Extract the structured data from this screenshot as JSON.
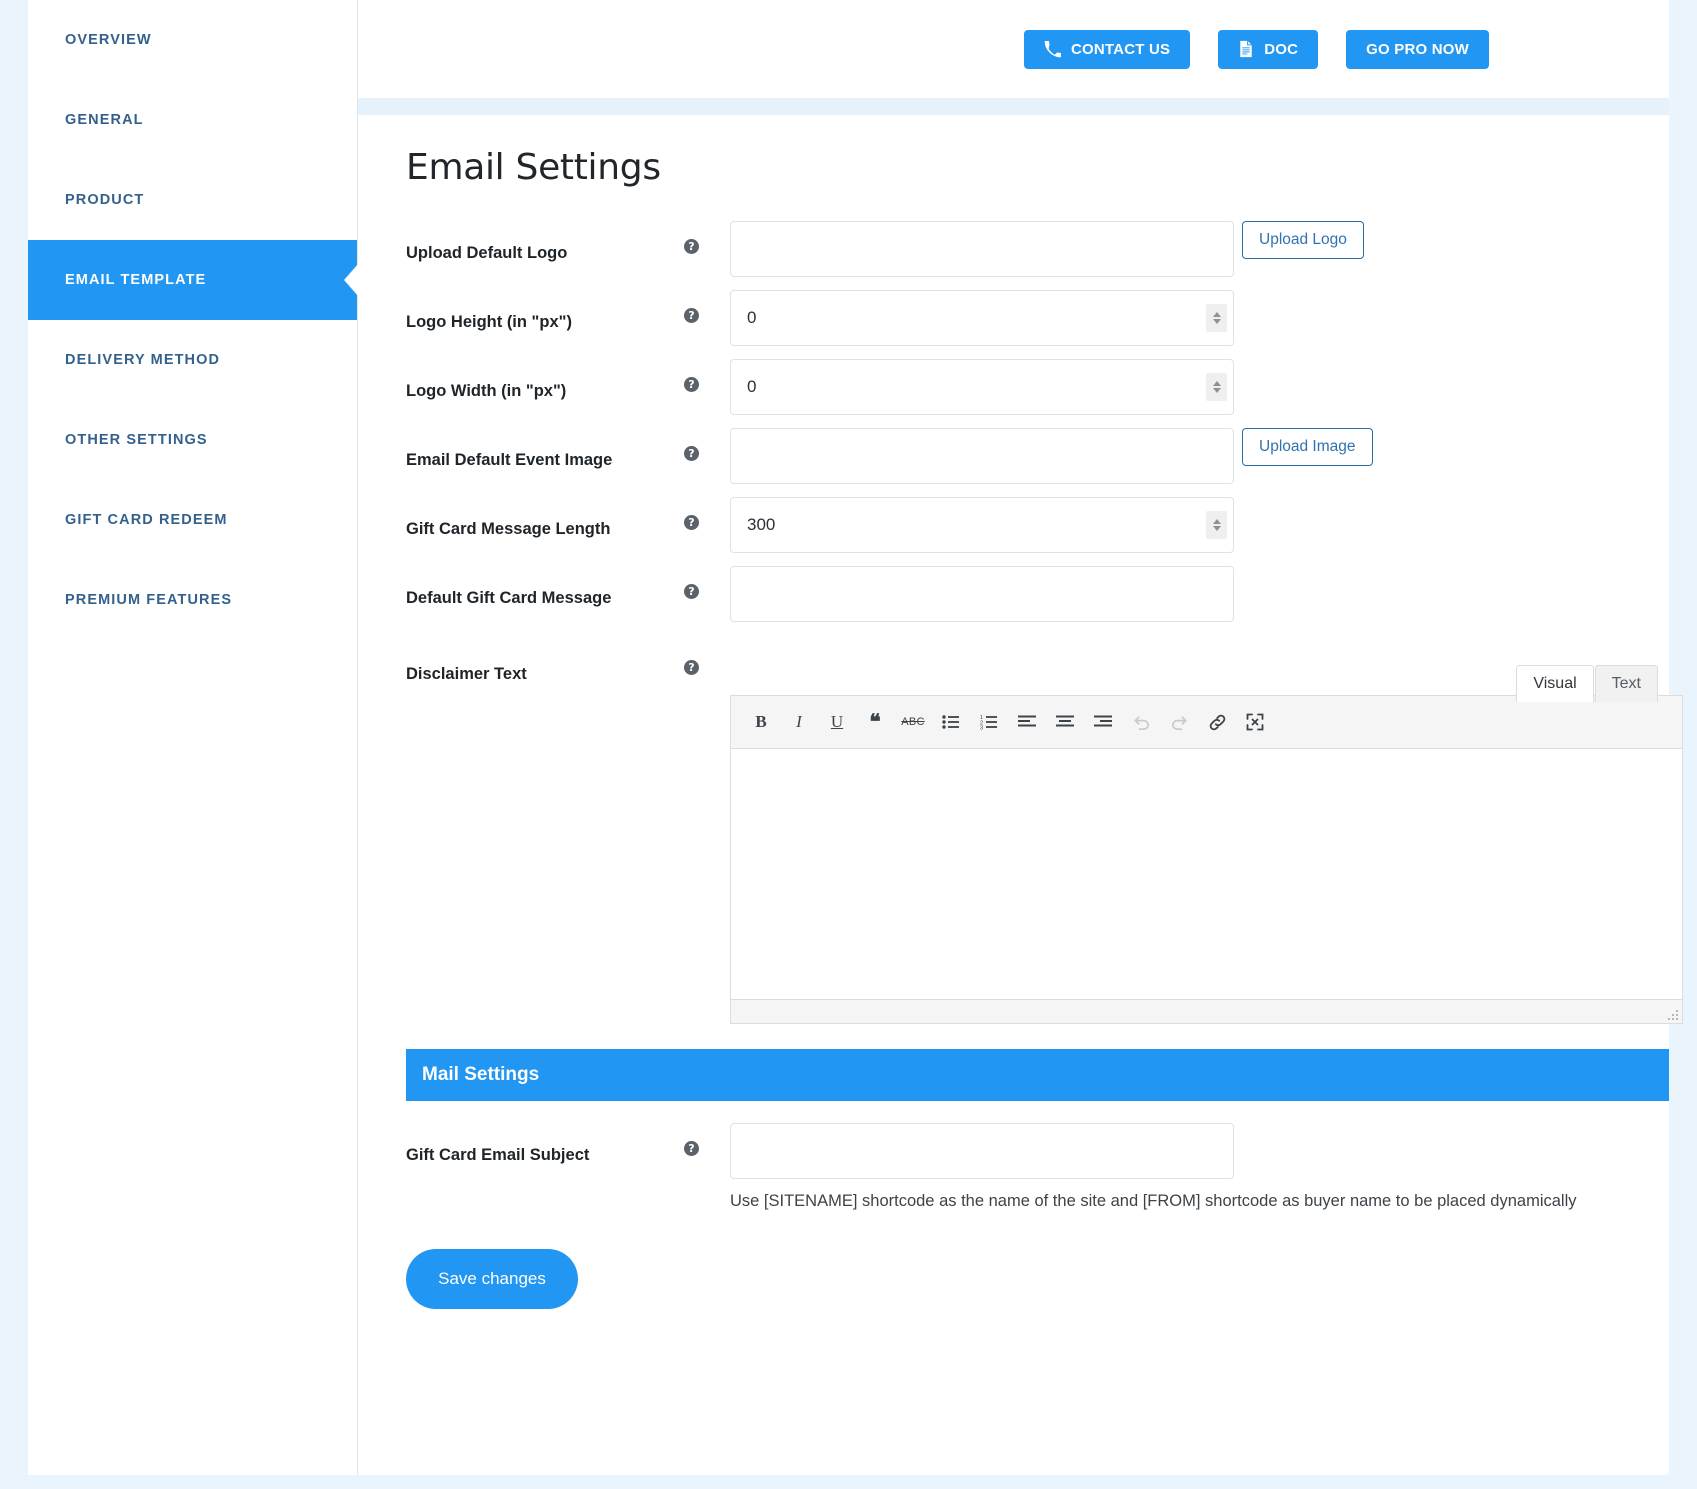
{
  "topbar": {
    "buttons": [
      {
        "label": "CONTACT US",
        "icon": "phone-icon"
      },
      {
        "label": "DOC",
        "icon": "document-icon"
      },
      {
        "label": "GO PRO NOW",
        "icon": ""
      }
    ]
  },
  "sidebar": {
    "items": [
      {
        "label": "OVERVIEW",
        "active": false
      },
      {
        "label": "GENERAL",
        "active": false
      },
      {
        "label": "PRODUCT",
        "active": false
      },
      {
        "label": "EMAIL TEMPLATE",
        "active": true
      },
      {
        "label": "DELIVERY METHOD",
        "active": false
      },
      {
        "label": "OTHER SETTINGS",
        "active": false
      },
      {
        "label": "GIFT CARD REDEEM",
        "active": false
      },
      {
        "label": "PREMIUM FEATURES",
        "active": false
      }
    ]
  },
  "main": {
    "title": "Email Settings",
    "fields": {
      "upload_logo": {
        "label": "Upload Default Logo",
        "value": "",
        "button": "Upload Logo"
      },
      "logo_height": {
        "label": "Logo Height (in \"px\")",
        "value": "0"
      },
      "logo_width": {
        "label": "Logo Width (in \"px\")",
        "value": "0"
      },
      "event_image": {
        "label": "Email Default Event Image",
        "value": "",
        "button": "Upload Image"
      },
      "message_length": {
        "label": "Gift Card Message Length",
        "value": "300"
      },
      "default_message": {
        "label": "Default Gift Card Message",
        "value": ""
      },
      "disclaimer": {
        "label": "Disclaimer Text",
        "value": ""
      },
      "email_subject": {
        "label": "Gift Card Email Subject",
        "value": ""
      }
    },
    "editor": {
      "tabs": [
        {
          "label": "Visual",
          "active": true
        },
        {
          "label": "Text",
          "active": false
        }
      ],
      "toolbar": [
        {
          "name": "bold-icon",
          "glyph": "B"
        },
        {
          "name": "italic-icon",
          "glyph": "I"
        },
        {
          "name": "underline-icon",
          "glyph": "U"
        },
        {
          "name": "blockquote-icon",
          "glyph": "❝"
        },
        {
          "name": "strikethrough-icon",
          "glyph": "ABC"
        },
        {
          "name": "bullet-list-icon",
          "glyph": ""
        },
        {
          "name": "numbered-list-icon",
          "glyph": ""
        },
        {
          "name": "align-left-icon",
          "glyph": ""
        },
        {
          "name": "align-center-icon",
          "glyph": ""
        },
        {
          "name": "align-right-icon",
          "glyph": ""
        },
        {
          "name": "undo-icon",
          "glyph": ""
        },
        {
          "name": "redo-icon",
          "glyph": ""
        },
        {
          "name": "link-icon",
          "glyph": ""
        },
        {
          "name": "fullscreen-icon",
          "glyph": ""
        }
      ],
      "content": ""
    },
    "mail_settings": {
      "heading": "Mail Settings",
      "hint": "Use [SITENAME] shortcode as the name of the site and [FROM] shortcode as buyer name to be placed dynamically"
    },
    "save_label": "Save changes"
  },
  "colors": {
    "accent": "#2196f3",
    "sidebar_text": "#34618c",
    "page_bg": "#eaf4fd",
    "help_dot": "#5b6269",
    "upload_border": "#2e6da4"
  }
}
